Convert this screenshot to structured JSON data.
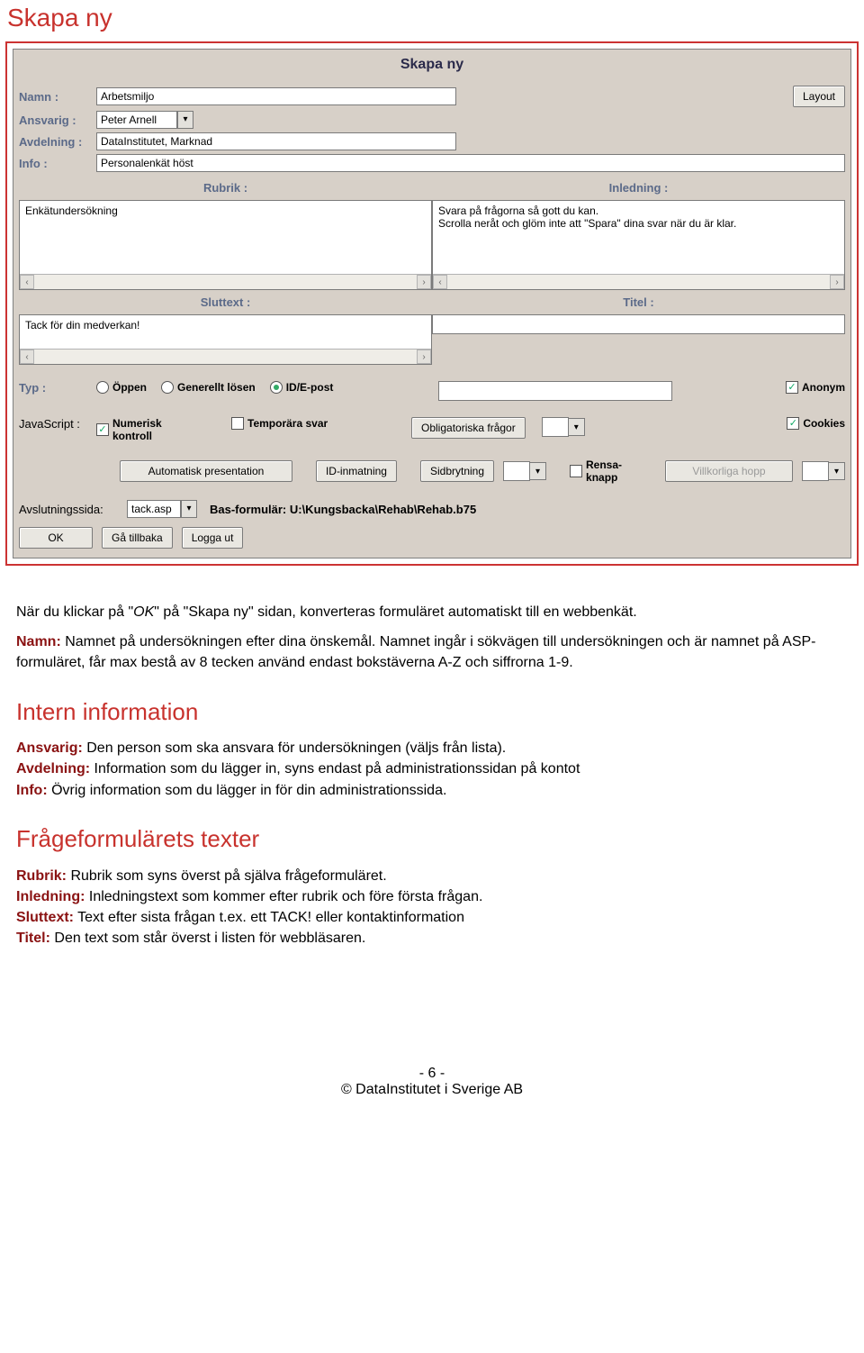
{
  "page_heading": "Skapa ny",
  "panel": {
    "title": "Skapa ny",
    "namn_label": "Namn :",
    "namn_value": "Arbetsmiljo",
    "layout_btn": "Layout",
    "ansvarig_label": "Ansvarig :",
    "ansvarig_value": "Peter Arnell",
    "avdelning_label": "Avdelning :",
    "avdelning_value": "DataInstitutet, Marknad",
    "info_label": "Info :",
    "info_value": "Personalenkät höst",
    "rubrik_header": "Rubrik :",
    "inledning_header": "Inledning :",
    "rubrik_text": "Enkätundersökning",
    "inledning_text": "Svara på frågorna så gott du kan.\nScrolla neråt och glöm inte att \"Spara\" dina svar när du är klar.",
    "sluttext_header": "Sluttext :",
    "titel_header": "Titel :",
    "sluttext_text": "Tack för din medverkan!",
    "titel_text": "",
    "typ_label": "Typ :",
    "typ_opt1": "Öppen",
    "typ_opt2": "Generellt lösen",
    "typ_opt3": "ID/E-post",
    "anonym": "Anonym",
    "javascript_label": "JavaScript :",
    "js_opt1": "Numerisk kontroll",
    "js_opt2": "Temporära svar",
    "obligatoriska": "Obligatoriska frågor",
    "cookies": "Cookies",
    "btn_autopres": "Automatisk presentation",
    "btn_idin": "ID-inmatning",
    "btn_sidbr": "Sidbrytning",
    "rensa": "Rensa-knapp",
    "btn_villkor": "Villkorliga hopp",
    "avslut_label": "Avslutningssida:",
    "avslut_value": "tack.asp",
    "basform": "Bas-formulär: U:\\Kungsbacka\\Rehab\\Rehab.b75",
    "btn_ok": "OK",
    "btn_back": "Gå tillbaka",
    "btn_logout": "Logga ut"
  },
  "doc": {
    "p1_a": "När du klickar på \"",
    "p1_ok": "OK",
    "p1_b": "\" på \"Skapa ny\" sidan, konverteras formuläret automatiskt till en webbenkät.",
    "namn_lead": "Namn:",
    "namn_txt": " Namnet på undersökningen efter dina önskemål. Namnet ingår i sökvägen till undersökningen och är namnet på ASP-formuläret, får max bestå av 8 tecken använd endast bokstäverna A-Z och siffrorna 1-9.",
    "h_intern": "Intern information",
    "ansv_lead": "Ansvarig:",
    "ansv_txt": " Den person som ska ansvara för undersökningen (väljs från lista).",
    "avd_lead": "Avdelning:",
    "avd_txt": " Information som du lägger in, syns endast på administrationssidan på kontot",
    "info_lead": "Info:",
    "info_txt": " Övrig information som du lägger in för din administrationssida.",
    "h_frage": "Frågeformulärets texter",
    "rub_lead": "Rubrik:",
    "rub_txt": " Rubrik som syns överst på själva frågeformuläret.",
    "inl_lead": "Inledning:",
    "inl_txt": " Inledningstext som kommer efter rubrik och före första frågan.",
    "slut_lead": "Sluttext:",
    "slut_txt": " Text efter sista frågan t.ex. ett TACK! eller kontaktinformation",
    "tit_lead": "Titel:",
    "tit_txt": " Den text som står överst i listen för webbläsaren."
  },
  "footer": {
    "page_no": "- 6 -",
    "copyright": "© DataInstitutet i Sverige AB"
  }
}
